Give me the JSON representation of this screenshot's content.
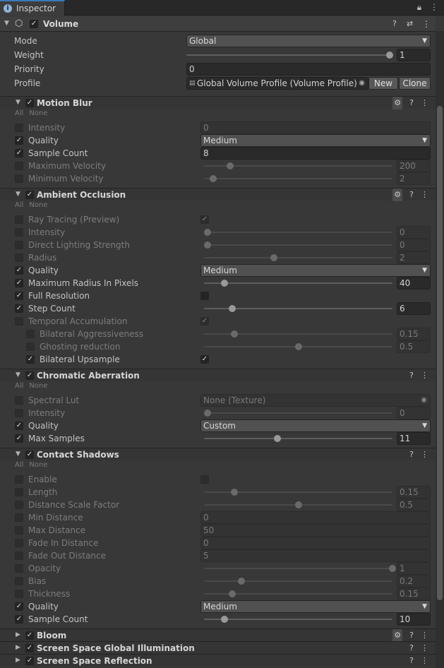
{
  "tab": {
    "title": "Inspector",
    "lock_icon": "lock-icon",
    "menu_icon": "kebab-menu-icon"
  },
  "component": {
    "title": "Volume",
    "mode_label": "Mode",
    "mode_value": "Global",
    "weight_label": "Weight",
    "weight_value": "1",
    "weight_fraction": 1.0,
    "priority_label": "Priority",
    "priority_value": "0",
    "profile_label": "Profile",
    "profile_value": "Global Volume Profile (Volume Profile)",
    "new_button": "New",
    "clone_button": "Clone"
  },
  "all_label": "All",
  "none_label": "None",
  "sections": {
    "motion_blur": {
      "title": "Motion Blur",
      "rows": [
        {
          "label": "Intensity",
          "value": "0"
        },
        {
          "label": "Quality",
          "value": "Medium"
        },
        {
          "label": "Sample Count",
          "value": "8"
        },
        {
          "label": "Maximum Velocity",
          "value": "200"
        },
        {
          "label": "Minimum Velocity",
          "value": "2"
        }
      ]
    },
    "ambient_occlusion": {
      "title": "Ambient Occlusion",
      "rows": [
        {
          "label": "Ray Tracing (Preview)"
        },
        {
          "label": "Intensity",
          "value": "0"
        },
        {
          "label": "Direct Lighting Strength",
          "value": "0"
        },
        {
          "label": "Radius",
          "value": "2"
        },
        {
          "label": "Quality",
          "value": "Medium"
        },
        {
          "label": "Maximum Radius In Pixels",
          "value": "40"
        },
        {
          "label": "Full Resolution"
        },
        {
          "label": "Step Count",
          "value": "6"
        },
        {
          "label": "Temporal Accumulation"
        },
        {
          "label": "Bilateral Aggressiveness",
          "value": "0.15"
        },
        {
          "label": "Ghosting reduction",
          "value": "0.5"
        },
        {
          "label": "Bilateral Upsample"
        }
      ]
    },
    "chromatic_aberration": {
      "title": "Chromatic Aberration",
      "rows": [
        {
          "label": "Spectral Lut",
          "value": "None (Texture)"
        },
        {
          "label": "Intensity",
          "value": "0"
        },
        {
          "label": "Quality",
          "value": "Custom"
        },
        {
          "label": "Max Samples",
          "value": "11"
        }
      ]
    },
    "contact_shadows": {
      "title": "Contact Shadows",
      "rows": [
        {
          "label": "Enable"
        },
        {
          "label": "Length",
          "value": "0.15"
        },
        {
          "label": "Distance Scale Factor",
          "value": "0.5"
        },
        {
          "label": "Min Distance",
          "value": "0"
        },
        {
          "label": "Max Distance",
          "value": "50"
        },
        {
          "label": "Fade In Distance",
          "value": "0"
        },
        {
          "label": "Fade Out Distance",
          "value": "5"
        },
        {
          "label": "Opacity",
          "value": "1"
        },
        {
          "label": "Bias",
          "value": "0.2"
        },
        {
          "label": "Thickness",
          "value": "0.15"
        },
        {
          "label": "Quality",
          "value": "Medium"
        },
        {
          "label": "Sample Count",
          "value": "10"
        }
      ]
    },
    "bloom": {
      "title": "Bloom"
    },
    "ssgi": {
      "title": "Screen Space Global Illumination"
    },
    "ssr": {
      "title": "Screen Space Reflection"
    }
  }
}
